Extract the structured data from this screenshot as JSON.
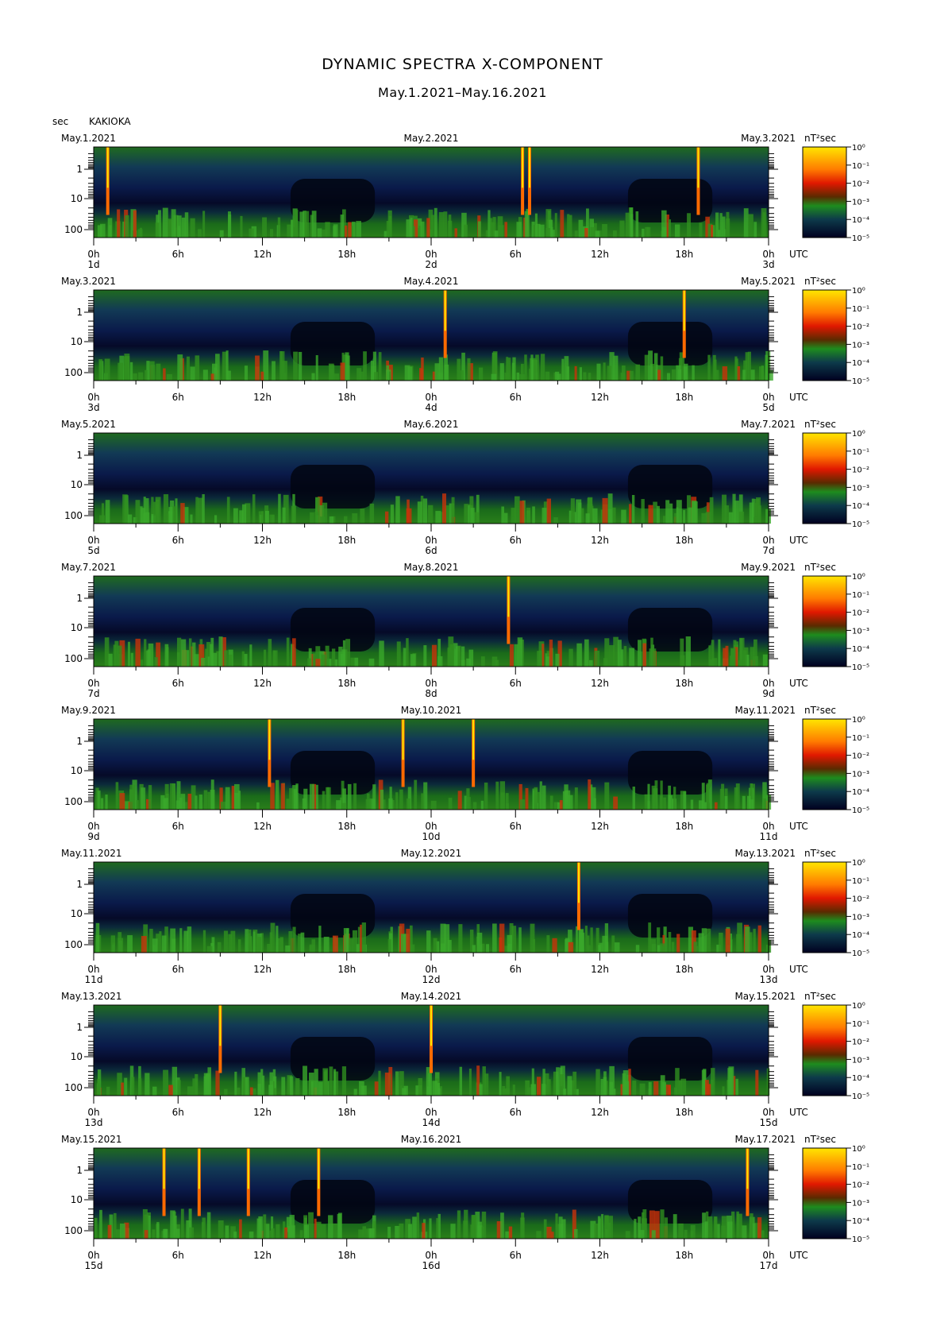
{
  "title": "DYNAMIC SPECTRA X-COMPONENT",
  "subtitle": "May.1.2021–May.16.2021",
  "station": "KAKIOKA",
  "y_unit": "sec",
  "power_unit": "nT²sec",
  "utc_label": "UTC",
  "x_tick_labels": [
    "0h",
    "6h",
    "12h",
    "18h",
    "0h",
    "6h",
    "12h",
    "18h",
    "0h"
  ],
  "y_tick_labels": [
    "1",
    "10",
    "100"
  ],
  "colorbar_labels": [
    "10⁰",
    "10⁻¹",
    "10⁻²",
    "10⁻³",
    "10⁻⁴",
    "10⁻⁵"
  ],
  "colors": {
    "background": "#000020",
    "low": "#0b1f6b",
    "mid": "#1a8c1a",
    "high": "#ff2200",
    "max": "#ffff00"
  },
  "chart_data": [
    {
      "type": "heatmap",
      "left_date": "May.1.2021",
      "mid_date": "May.2.2021",
      "right_date": "May.3.2021",
      "day_labels": [
        "1d",
        "2d",
        "3d"
      ],
      "events_hours": [
        1,
        30.5,
        31,
        43
      ]
    },
    {
      "type": "heatmap",
      "left_date": "May.3.2021",
      "mid_date": "May.4.2021",
      "right_date": "May.5.2021",
      "day_labels": [
        "3d",
        "4d",
        "5d"
      ],
      "events_hours": [
        25,
        42
      ]
    },
    {
      "type": "heatmap",
      "left_date": "May.5.2021",
      "mid_date": "May.6.2021",
      "right_date": "May.7.2021",
      "day_labels": [
        "5d",
        "6d",
        "7d"
      ],
      "events_hours": []
    },
    {
      "type": "heatmap",
      "left_date": "May.7.2021",
      "mid_date": "May.8.2021",
      "right_date": "May.9.2021",
      "day_labels": [
        "7d",
        "8d",
        "9d"
      ],
      "events_hours": [
        29.5
      ]
    },
    {
      "type": "heatmap",
      "left_date": "May.9.2021",
      "mid_date": "May.10.2021",
      "right_date": "May.11.2021",
      "day_labels": [
        "9d",
        "10d",
        "11d"
      ],
      "events_hours": [
        12.5,
        22,
        27
      ]
    },
    {
      "type": "heatmap",
      "left_date": "May.11.2021",
      "mid_date": "May.12.2021",
      "right_date": "May.13.2021",
      "day_labels": [
        "11d",
        "12d",
        "13d"
      ],
      "events_hours": [
        34.5
      ]
    },
    {
      "type": "heatmap",
      "left_date": "May.13.2021",
      "mid_date": "May.14.2021",
      "right_date": "May.15.2021",
      "day_labels": [
        "13d",
        "14d",
        "15d"
      ],
      "events_hours": [
        9,
        24
      ]
    },
    {
      "type": "heatmap",
      "left_date": "May.15.2021",
      "mid_date": "May.16.2021",
      "right_date": "May.17.2021",
      "day_labels": [
        "15d",
        "16d",
        "17d"
      ],
      "events_hours": [
        5,
        7.5,
        11,
        16,
        46.5
      ]
    }
  ]
}
